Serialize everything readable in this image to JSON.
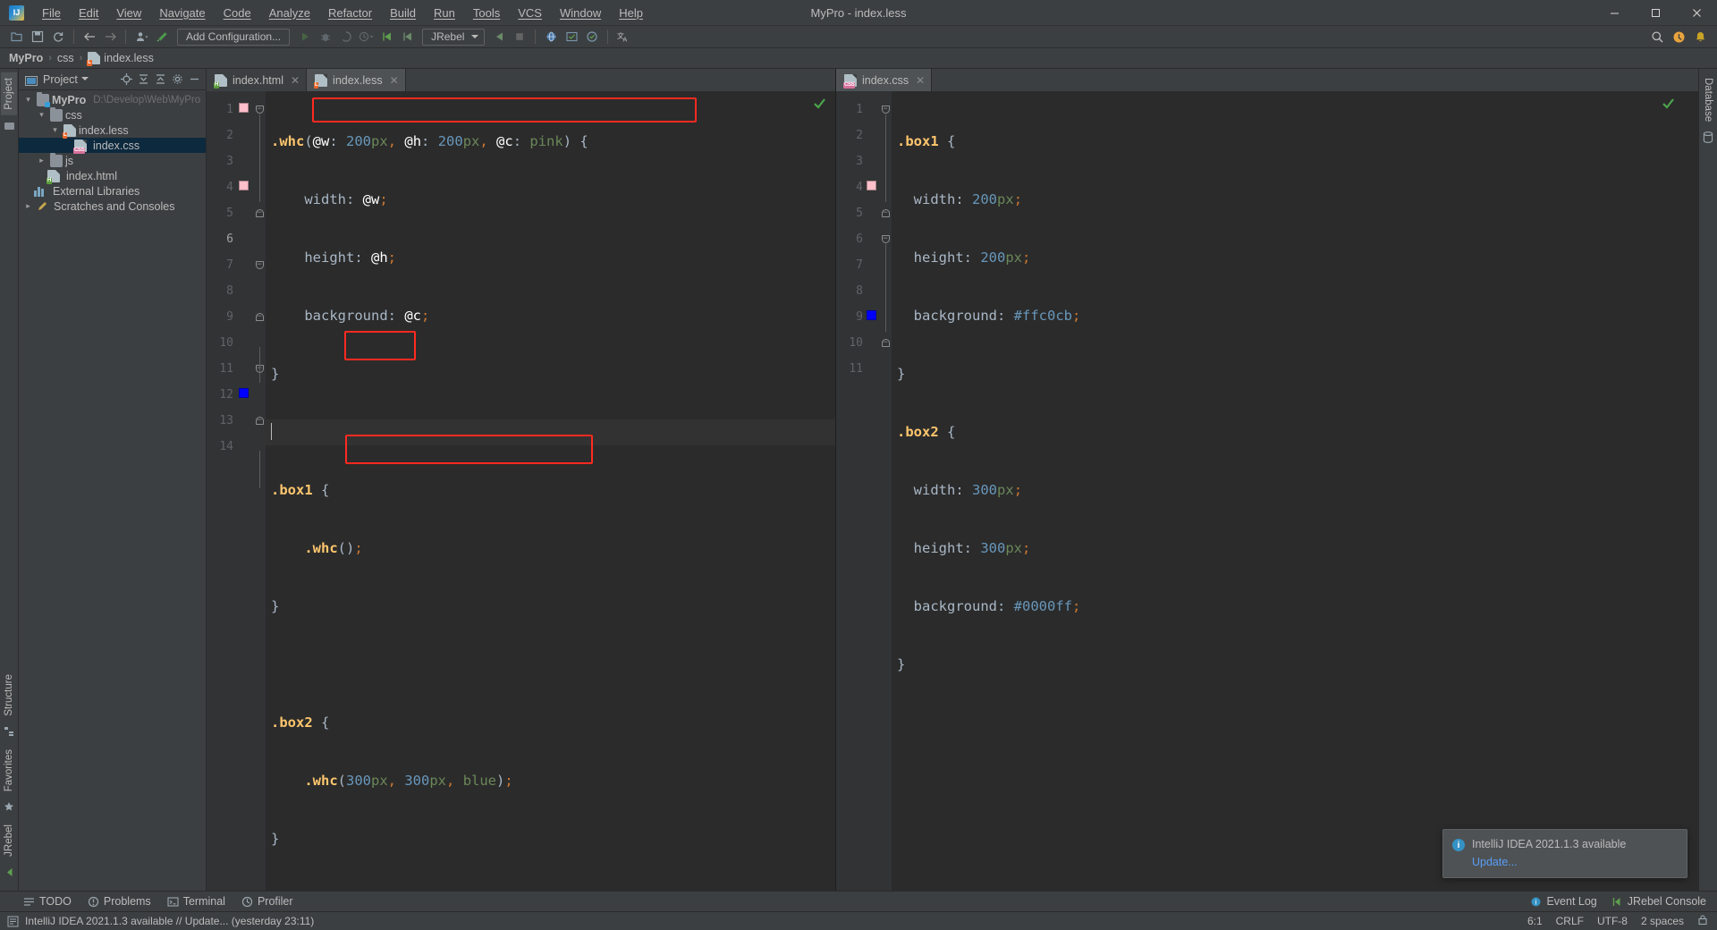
{
  "window": {
    "title": "MyPro - index.less",
    "logo_icon": "intellij-idea-logo",
    "minimize_label": "—",
    "maximize_label": "☐",
    "close_label": "✕"
  },
  "menu": {
    "items": [
      {
        "label": "File",
        "mnemonic": "F"
      },
      {
        "label": "Edit",
        "mnemonic": "E"
      },
      {
        "label": "View",
        "mnemonic": "V"
      },
      {
        "label": "Navigate",
        "mnemonic": "N"
      },
      {
        "label": "Code",
        "mnemonic": "C"
      },
      {
        "label": "Analyze",
        "mnemonic": "z"
      },
      {
        "label": "Refactor",
        "mnemonic": "R"
      },
      {
        "label": "Build",
        "mnemonic": "B"
      },
      {
        "label": "Run",
        "mnemonic": "u"
      },
      {
        "label": "Tools",
        "mnemonic": "T"
      },
      {
        "label": "VCS",
        "mnemonic": "S"
      },
      {
        "label": "Window",
        "mnemonic": "W"
      },
      {
        "label": "Help",
        "mnemonic": "H"
      }
    ]
  },
  "toolbar": {
    "open_icon": "folder-open-icon",
    "save_icon": "save-icon",
    "sync_icon": "refresh-icon",
    "back_icon": "arrow-left-icon",
    "forward_icon": "arrow-right-icon",
    "profile_icon": "user-profile-icon",
    "build_icon": "hammer-icon",
    "add_configuration": "Add Configuration...",
    "run_icon": "run-triangle-icon",
    "debug_icon": "debug-bug-icon",
    "run_coverage_icon": "coverage-icon",
    "profiler_icon": "profiler-clock-icon",
    "jrebel_run_icon": "jrebel-run-icon",
    "jrebel_debug_icon": "jrebel-debug-icon",
    "jrebel_selector": "JRebel",
    "jrebel_stop_icon": "jrebel-stop-icon",
    "stop_icon": "stop-square-icon",
    "browser_icon": "globe-icon",
    "validate_icon": "validate-icon",
    "inspect_icon": "inspection-icon",
    "translate_icon": "translate-icon",
    "search_icon": "search-icon",
    "plugin_icon": "plugin-update-icon",
    "notification_icon": "notification-icon"
  },
  "navbar": {
    "crumbs": [
      {
        "label": "MyPro",
        "icon": "project-icon"
      },
      {
        "label": "css",
        "icon": "folder-icon"
      },
      {
        "label": "index.less",
        "icon": "less-file-icon"
      }
    ],
    "separator": "›"
  },
  "left_strip": {
    "project_tab": "Project",
    "project_icon": "project-panel-icon",
    "structure_tab": "Structure",
    "structure_icon": "structure-icon",
    "favorites_tab": "Favorites",
    "favorites_icon": "star-icon",
    "jrebel_tab": "JRebel",
    "jrebel_icon": "jrebel-icon"
  },
  "right_strip": {
    "database_tab": "Database",
    "database_icon": "database-icon",
    "maven_icon": "maven-icon"
  },
  "project_panel": {
    "title": "Project",
    "dropdown_icon": "chevron-down-icon",
    "actions": [
      {
        "name": "locate-icon",
        "glyph": "⊕"
      },
      {
        "name": "expand-all-icon",
        "glyph": "⤓"
      },
      {
        "name": "collapse-all-icon",
        "glyph": "⤒"
      },
      {
        "name": "settings-gear-icon",
        "glyph": "⚙"
      },
      {
        "name": "hide-panel-icon",
        "glyph": "—"
      }
    ],
    "tree": [
      {
        "label": "MyPro",
        "path": "D:\\Develop\\Web\\MyPro",
        "depth": 0,
        "arrow": "expanded",
        "icon": "folder-module",
        "bold": true,
        "selected": false
      },
      {
        "label": "css",
        "path": "",
        "depth": 1,
        "arrow": "expanded",
        "icon": "folder",
        "bold": false,
        "selected": false
      },
      {
        "label": "index.less",
        "path": "",
        "depth": 2,
        "arrow": "expanded",
        "icon": "less-file",
        "bold": false,
        "selected": false
      },
      {
        "label": "index.css",
        "path": "",
        "depth": 3,
        "arrow": "none",
        "icon": "css-file",
        "bold": false,
        "selected": true
      },
      {
        "label": "js",
        "path": "",
        "depth": 1,
        "arrow": "collapsed",
        "icon": "folder",
        "bold": false,
        "selected": false
      },
      {
        "label": "index.html",
        "path": "",
        "depth": 1,
        "arrow": "none",
        "icon": "html-file",
        "bold": false,
        "selected": false
      },
      {
        "label": "External Libraries",
        "path": "",
        "depth": 0,
        "arrow": "none",
        "icon": "library",
        "bold": false,
        "selected": false
      },
      {
        "label": "Scratches and Consoles",
        "path": "",
        "depth": 0,
        "arrow": "collapsed",
        "icon": "scratches",
        "bold": false,
        "selected": false
      }
    ]
  },
  "editor_left": {
    "tabs": [
      {
        "label": "index.html",
        "icon": "html-file",
        "active": false,
        "close": "✕"
      },
      {
        "label": "index.less",
        "icon": "less-file",
        "active": true,
        "close": "✕"
      }
    ],
    "inspection_status_icon": "checkmark-ok-icon",
    "cursor_line": 6,
    "lines": [
      {
        "num": 1,
        "text": ".whc(@w: 200px, @h: 200px, @c: pink) {",
        "swatch": "#ffc0cb",
        "fold": "top"
      },
      {
        "num": 2,
        "text": "    width: @w;",
        "swatch": "",
        "fold": ""
      },
      {
        "num": 3,
        "text": "    height: @h;",
        "swatch": "",
        "fold": ""
      },
      {
        "num": 4,
        "text": "    background: @c;",
        "swatch": "#ffc0cb",
        "fold": ""
      },
      {
        "num": 5,
        "text": "}",
        "swatch": "",
        "fold": "bottom"
      },
      {
        "num": 6,
        "text": "",
        "swatch": "",
        "fold": ""
      },
      {
        "num": 7,
        "text": ".box1 {",
        "swatch": "",
        "fold": "top"
      },
      {
        "num": 8,
        "text": "    .whc();",
        "swatch": "",
        "fold": ""
      },
      {
        "num": 9,
        "text": "}",
        "swatch": "",
        "fold": "bottom"
      },
      {
        "num": 10,
        "text": "",
        "swatch": "",
        "fold": ""
      },
      {
        "num": 11,
        "text": ".box2 {",
        "swatch": "",
        "fold": "top"
      },
      {
        "num": 12,
        "text": "    .whc(300px, 300px, blue);",
        "swatch": "#0000ff",
        "fold": ""
      },
      {
        "num": 13,
        "text": "}",
        "swatch": "",
        "fold": "bottom"
      },
      {
        "num": 14,
        "text": "",
        "swatch": "",
        "fold": ""
      }
    ],
    "annotations": [
      {
        "name": "mixin-definition-highlight",
        "target_line": 1
      },
      {
        "name": "mixin-call-noargs-highlight",
        "target_line": 8
      },
      {
        "name": "mixin-call-args-highlight",
        "target_line": 12
      }
    ]
  },
  "editor_right": {
    "tabs": [
      {
        "label": "index.css",
        "icon": "css-file",
        "active": true,
        "close": "✕"
      }
    ],
    "inspection_status_icon": "checkmark-ok-icon",
    "lines": [
      {
        "num": 1,
        "text": ".box1 {",
        "swatch": "",
        "fold": "top"
      },
      {
        "num": 2,
        "text": "  width: 200px;",
        "swatch": "",
        "fold": ""
      },
      {
        "num": 3,
        "text": "  height: 200px;",
        "swatch": "",
        "fold": ""
      },
      {
        "num": 4,
        "text": "  background: #ffc0cb;",
        "swatch": "#ffc0cb",
        "fold": ""
      },
      {
        "num": 5,
        "text": "}",
        "swatch": "",
        "fold": "bottom"
      },
      {
        "num": 6,
        "text": ".box2 {",
        "swatch": "",
        "fold": "top"
      },
      {
        "num": 7,
        "text": "  width: 300px;",
        "swatch": "",
        "fold": ""
      },
      {
        "num": 8,
        "text": "  height: 300px;",
        "swatch": "",
        "fold": ""
      },
      {
        "num": 9,
        "text": "  background: #0000ff;",
        "swatch": "#0000ff",
        "fold": ""
      },
      {
        "num": 10,
        "text": "}",
        "swatch": "",
        "fold": "bottom"
      },
      {
        "num": 11,
        "text": "",
        "swatch": "",
        "fold": ""
      }
    ]
  },
  "notification": {
    "icon": "info-icon",
    "title": "IntelliJ IDEA 2021.1.3 available",
    "action": "Update..."
  },
  "bottom_bar": {
    "items": [
      {
        "label": "TODO",
        "icon": "todo-icon"
      },
      {
        "label": "Problems",
        "icon": "problems-icon"
      },
      {
        "label": "Terminal",
        "icon": "terminal-icon"
      },
      {
        "label": "Profiler",
        "icon": "profiler-icon"
      }
    ],
    "right": [
      {
        "label": "Event Log",
        "icon": "event-log-icon"
      },
      {
        "label": "JRebel Console",
        "icon": "jrebel-console-icon"
      }
    ]
  },
  "status_bar": {
    "message": "IntelliJ IDEA 2021.1.3 available  //  Update... (yesterday 23:11)",
    "message_icon": "status-info-icon",
    "caret_position": "6:1",
    "line_separator": "CRLF",
    "encoding": "UTF-8",
    "indent": "2 spaces",
    "lock_icon": "lock-icon"
  },
  "colors": {
    "accent": "#ff2a20",
    "pink": "#ffc0cb",
    "blue": "#0000ff",
    "ok_green": "#4ca54c",
    "link": "#589df6"
  }
}
